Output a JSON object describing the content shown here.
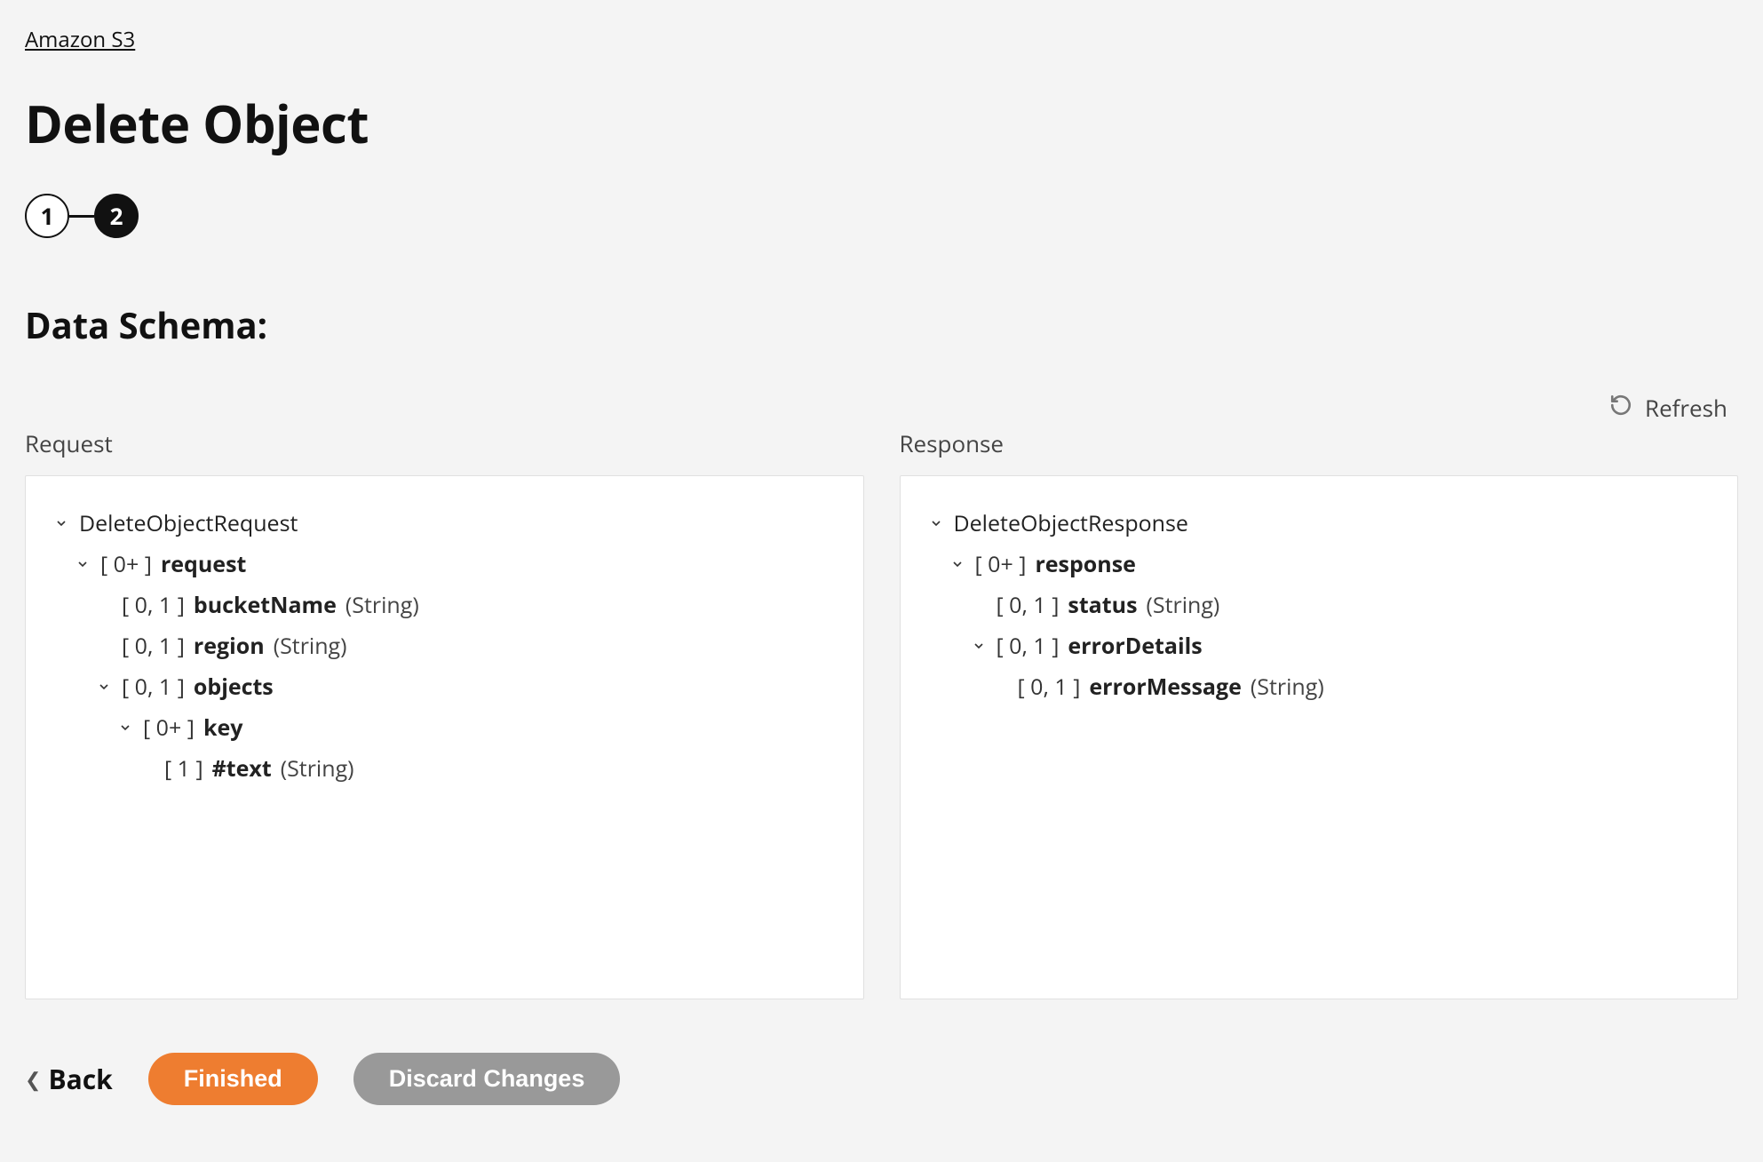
{
  "breadcrumb": {
    "label": "Amazon S3"
  },
  "page": {
    "title": "Delete Object"
  },
  "stepper": {
    "step1": "1",
    "step2": "2",
    "activeIndex": 1
  },
  "section": {
    "heading": "Data Schema:"
  },
  "refresh": {
    "label": "Refresh"
  },
  "request": {
    "label": "Request",
    "root": "DeleteObjectRequest",
    "rows": {
      "request": {
        "card": "[ 0+ ]",
        "name": "request",
        "type": ""
      },
      "bucketName": {
        "card": "[ 0, 1 ]",
        "name": "bucketName",
        "type": "(String)"
      },
      "region": {
        "card": "[ 0, 1 ]",
        "name": "region",
        "type": "(String)"
      },
      "objects": {
        "card": "[ 0, 1 ]",
        "name": "objects",
        "type": ""
      },
      "key": {
        "card": "[ 0+ ]",
        "name": "key",
        "type": ""
      },
      "text": {
        "card": "[ 1 ]",
        "name": "#text",
        "type": "(String)"
      }
    }
  },
  "response": {
    "label": "Response",
    "root": "DeleteObjectResponse",
    "rows": {
      "response": {
        "card": "[ 0+ ]",
        "name": "response",
        "type": ""
      },
      "status": {
        "card": "[ 0, 1 ]",
        "name": "status",
        "type": "(String)"
      },
      "errorDetails": {
        "card": "[ 0, 1 ]",
        "name": "errorDetails",
        "type": ""
      },
      "errorMessage": {
        "card": "[ 0, 1 ]",
        "name": "errorMessage",
        "type": "(String)"
      }
    }
  },
  "actions": {
    "back": "Back",
    "finished": "Finished",
    "discard": "Discard Changes"
  }
}
